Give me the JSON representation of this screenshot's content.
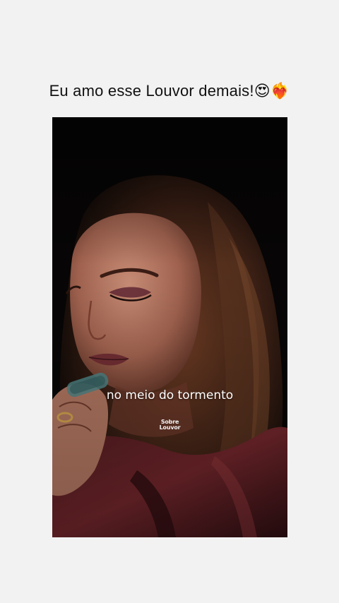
{
  "post": {
    "caption": "Eu amo esse Louvor demais!😍❤️‍🔥"
  },
  "video": {
    "subtitle": "no meio do tormento",
    "watermark_line1": "Sobre",
    "watermark_line2": "Louvor"
  },
  "colors": {
    "page_background": "#f3f2f2",
    "video_background": "#060606",
    "subtitle_text": "#ffffff"
  }
}
